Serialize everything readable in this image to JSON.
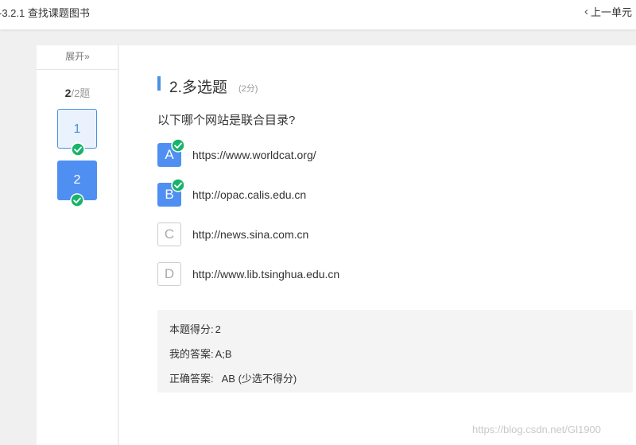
{
  "header": {
    "title": "-3.2.1 查找课题图书",
    "prev_unit": "上一单元"
  },
  "sidebar": {
    "expand_label": "展开»",
    "progress_current": "2",
    "progress_total": "/2题",
    "questions": [
      {
        "label": "1",
        "status": "answered-correct"
      },
      {
        "label": "2",
        "status": "current-correct"
      }
    ]
  },
  "question": {
    "title": "2.多选题",
    "score": "(2分)",
    "stem": "以下哪个网站是联合目录?",
    "options": [
      {
        "letter": "A",
        "text": "https://www.worldcat.org/",
        "selected": true,
        "correct": true
      },
      {
        "letter": "B",
        "text": "http://opac.calis.edu.cn",
        "selected": true,
        "correct": true
      },
      {
        "letter": "C",
        "text": "http://news.sina.com.cn",
        "selected": false,
        "correct": false
      },
      {
        "letter": "D",
        "text": "http://www.lib.tsinghua.edu.cn",
        "selected": false,
        "correct": false
      }
    ]
  },
  "result": {
    "score_label": "本题得分:",
    "score_value": "2",
    "my_answer_label": "我的答案:",
    "my_answer_value": "A;B",
    "correct_label": "正确答案:",
    "correct_value": "AB (少选不得分)"
  },
  "watermark": "https://blog.csdn.net/Gl1900",
  "colors": {
    "accent": "#4f8ff2",
    "check": "#19b36b",
    "answer_bg": "#f4f4f4"
  },
  "icons": {
    "check": "check-circle-icon",
    "prev": "chevron-left-icon"
  }
}
